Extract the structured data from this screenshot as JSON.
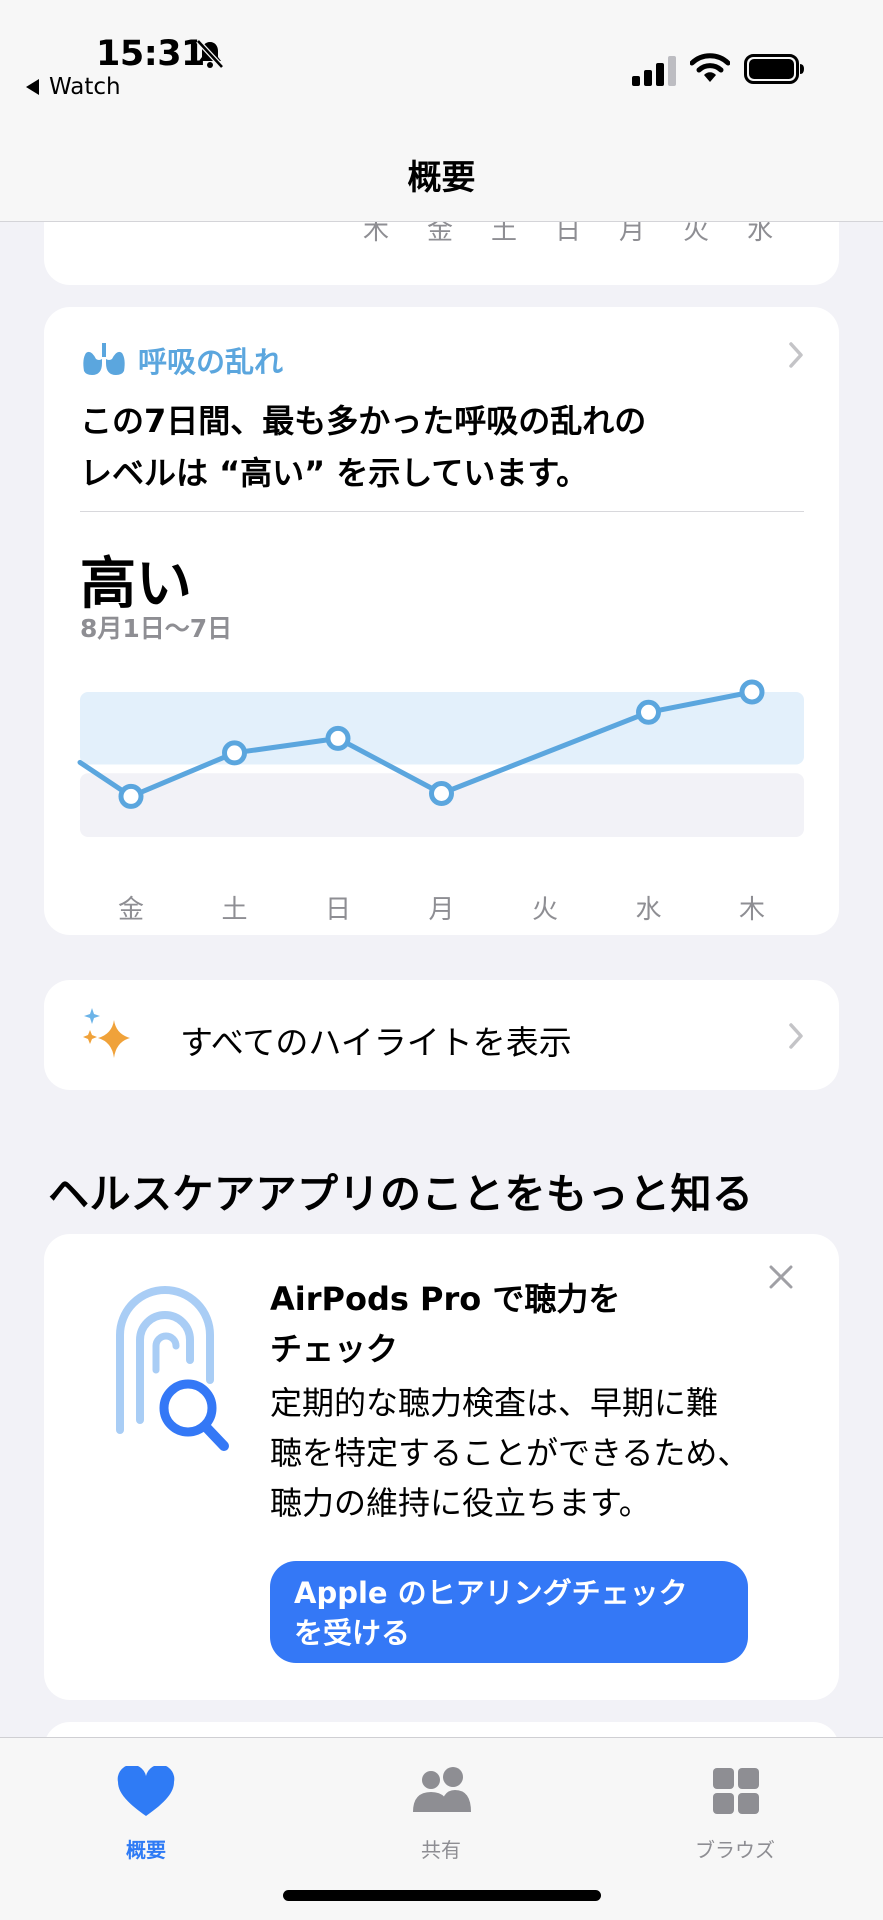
{
  "status_bar": {
    "time": "15:31",
    "back_label": "Watch"
  },
  "nav": {
    "title": "概要"
  },
  "prev_card": {
    "days": [
      "木",
      "金",
      "土",
      "日",
      "月",
      "火",
      "水"
    ]
  },
  "breathing": {
    "title": "呼吸の乱れ",
    "description_line1": "この7日間、最も多かった呼吸の乱れの",
    "description_line2": "レベルは “高い” を示しています。",
    "level": "高い",
    "date_range": "8月1日〜7日",
    "chart_data": {
      "type": "line",
      "categories": [
        "金",
        "土",
        "日",
        "月",
        "火",
        "水",
        "木"
      ],
      "series": [
        {
          "values": [
            0.28,
            0.58,
            0.68,
            0.3,
            null,
            0.86,
            1.0
          ],
          "color": "#5ba6de"
        }
      ],
      "bands": [
        {
          "label": "",
          "range": [
            0.5,
            1.0
          ],
          "color": "#e3f0fb"
        },
        {
          "label": "",
          "range": [
            0.0,
            0.44
          ],
          "color": "#f2f2f7"
        }
      ],
      "grid": false
    }
  },
  "highlights": {
    "label": "すべてのハイライトを表示"
  },
  "section": {
    "title": "ヘルスケアアプリのことをもっと知る"
  },
  "airpods": {
    "title_line1": "AirPods Pro で聴力を",
    "title_line2": "チェック",
    "body_line1": "定期的な聴力検査は、早期に難",
    "body_line2": "聴を特定することができるため、",
    "body_line3": "聴力の維持に役立ちます。",
    "button_line1": "Apple のヒアリングチェック",
    "button_line2": "を受ける"
  },
  "tabs": [
    {
      "label": "概要",
      "icon": "heart-icon",
      "active": true
    },
    {
      "label": "共有",
      "icon": "people-icon",
      "active": false
    },
    {
      "label": "ブラウズ",
      "icon": "grid-icon",
      "active": false
    }
  ],
  "colors": {
    "accent": "#2f7bf5",
    "breath": "#5ba6de",
    "button": "#3478f6"
  }
}
